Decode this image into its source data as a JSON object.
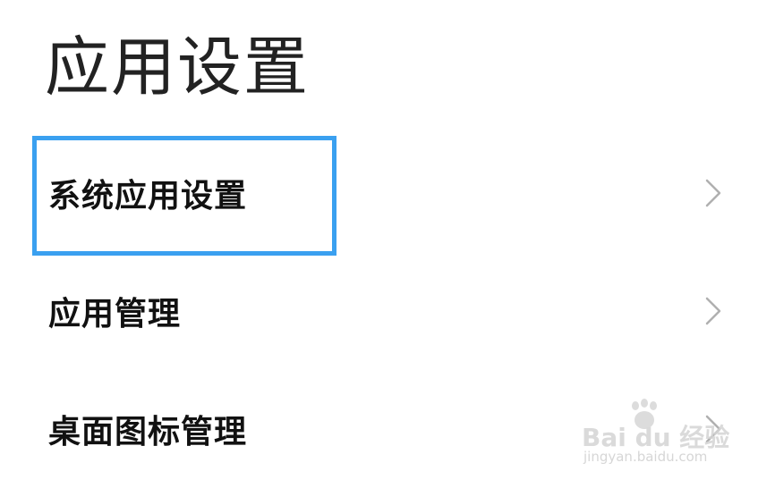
{
  "page": {
    "title": "应用设置"
  },
  "settings": {
    "items": [
      {
        "label": "系统应用设置",
        "highlighted": true
      },
      {
        "label": "应用管理",
        "highlighted": false
      },
      {
        "label": "桌面图标管理",
        "highlighted": false
      }
    ]
  },
  "watermark": {
    "logo": "Bai du 经验",
    "url": "jingyan.baidu.com"
  },
  "colors": {
    "highlight": "#3aa0f0",
    "chevron": "#b0b0b0",
    "text": "#111111"
  },
  "icons": {
    "chevron": "chevron-right-icon",
    "watermark": "baidu-paw-icon"
  }
}
